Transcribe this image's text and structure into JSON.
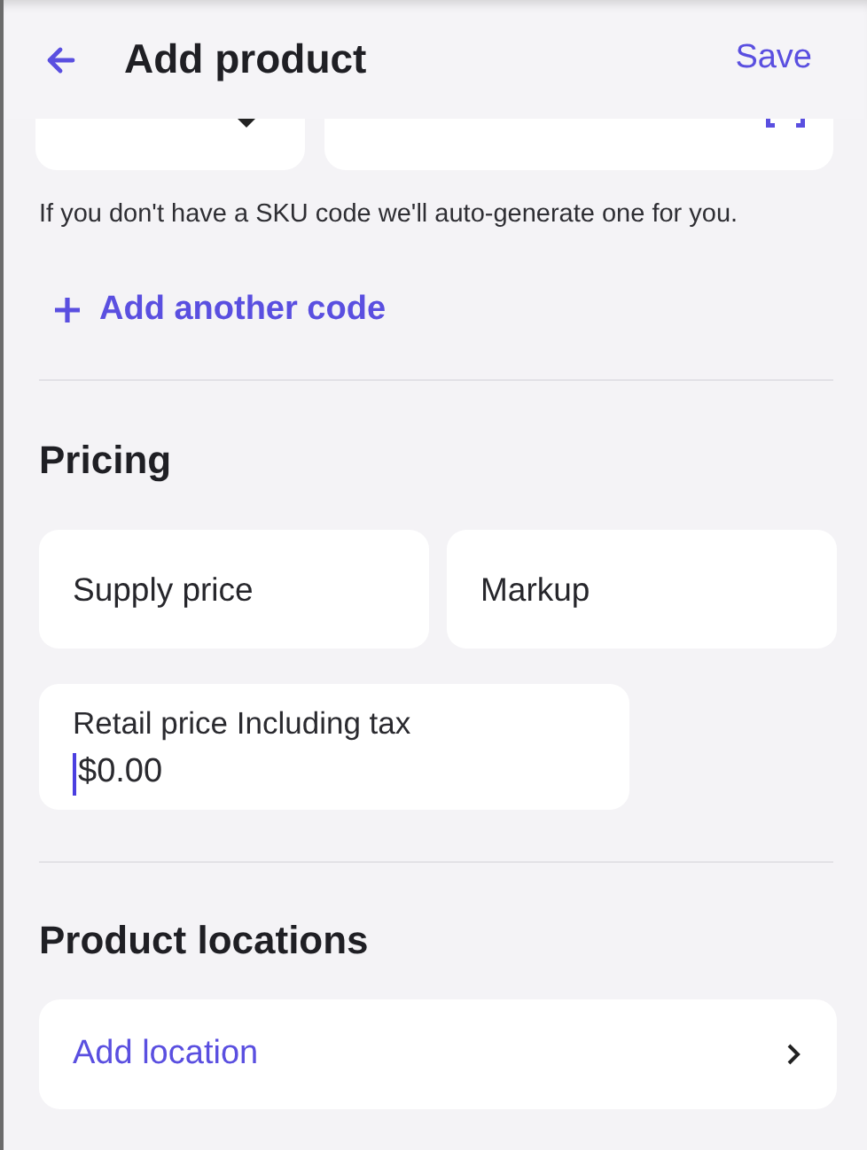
{
  "header": {
    "title": "Add product",
    "action": "Save"
  },
  "sku": {
    "note": "If you don't have a SKU code we'll auto-generate one for you.",
    "add_code": "Add another code"
  },
  "pricing": {
    "title": "Pricing",
    "fields": [
      {
        "placeholder": "Supply price"
      },
      {
        "placeholder": "Markup"
      }
    ],
    "retail": {
      "label": "Retail price Including tax",
      "value": "$0.00",
      "focused": true
    }
  },
  "locations": {
    "title": "Product locations",
    "add_location": "Add location"
  }
}
